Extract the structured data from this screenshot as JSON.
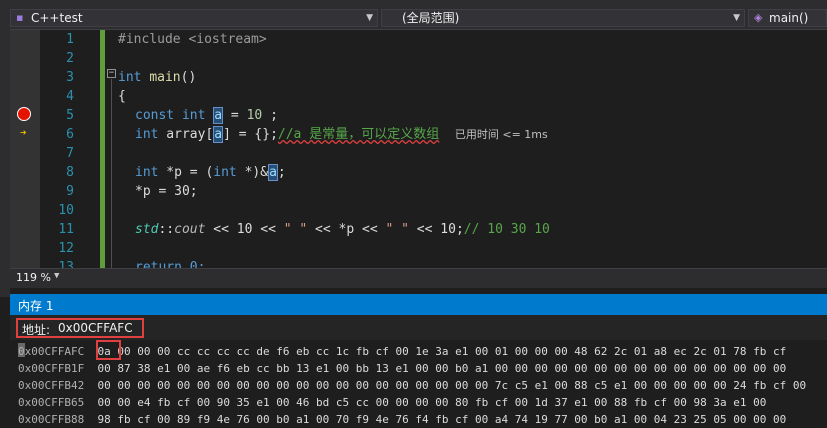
{
  "navbar": {
    "project": "C++test",
    "scope": "(全局范围)",
    "function": "main()"
  },
  "editor": {
    "line_numbers": [
      "1",
      "2",
      "3",
      "4",
      "5",
      "6",
      "7",
      "8",
      "9",
      "10",
      "11",
      "12",
      "13"
    ],
    "code": {
      "l1": "#include <iostream>",
      "l3a": "int",
      "l3b": "main",
      "l3c": "()",
      "l4": "{",
      "l5a": "const int",
      "l5b": "a",
      "l5c": " = ",
      "l5d": "10",
      "l5e": " ;",
      "l6a": "int",
      "l6b": " array[",
      "l6c": "a",
      "l6d": "] = {};",
      "l6e": "//a 是常量，可以定义数组",
      "l6f": "已用时间 <= 1ms",
      "l8a": "int",
      "l8b": " *p = (",
      "l8c": "int",
      "l8d": " *)&",
      "l8e": "a",
      "l8f": ";",
      "l9": "*p = 30;",
      "l11a": "std",
      "l11b": "::",
      "l11c": "cout",
      "l11d": " << 10 << ",
      "l11e": "\" \"",
      "l11f": " << *p << ",
      "l11g": "\" \"",
      "l11h": " << 10;",
      "l11i": "// 10 30 10",
      "l13": "return 0;"
    }
  },
  "status": {
    "zoom": "119 %"
  },
  "memory": {
    "title": "内存 1",
    "address_label": "地址:",
    "address_value": "0x00CFFAFC",
    "rows": [
      {
        "addr": "0x00CFFAFC",
        "bytes": "0a 00 00 00 cc cc cc cc de f6 eb cc 1c fb cf 00 1e 3a e1 00 01 00 00 00 48 62 2c 01 a8 ec 2c 01 78 fb cf"
      },
      {
        "addr": "0x00CFFB1F",
        "bytes": "00 87 38 e1 00 ae f6 eb cc bb 13 e1 00 bb 13 e1 00 00 b0 a1 00 00 00 00 00 00 00 00 00 00 00 00 00 00 00"
      },
      {
        "addr": "0x00CFFB42",
        "bytes": "00 00 00 00 00 00 00 00 00 00 00 00 00 00 00 00 00 00 00 00 7c c5 e1 00 88 c5 e1 00 00 00 00 00 24 fb cf 00"
      },
      {
        "addr": "0x00CFFB65",
        "bytes": "00 00 e4 fb cf 00 90 35 e1 00 46 bd c5 cc 00 00 00 00 80 fb cf 00 1d 37 e1 00 88 fb cf 00 98 3a e1 00"
      },
      {
        "addr": "0x00CFFB88",
        "bytes": "98 fb cf 00 89 f9 4e 76 00 b0 a1 00 70 f9 4e 76 f4 fb cf 00 a4 74 19 77 00 b0 a1 00 04 23 25 05 00 00 00"
      }
    ]
  }
}
